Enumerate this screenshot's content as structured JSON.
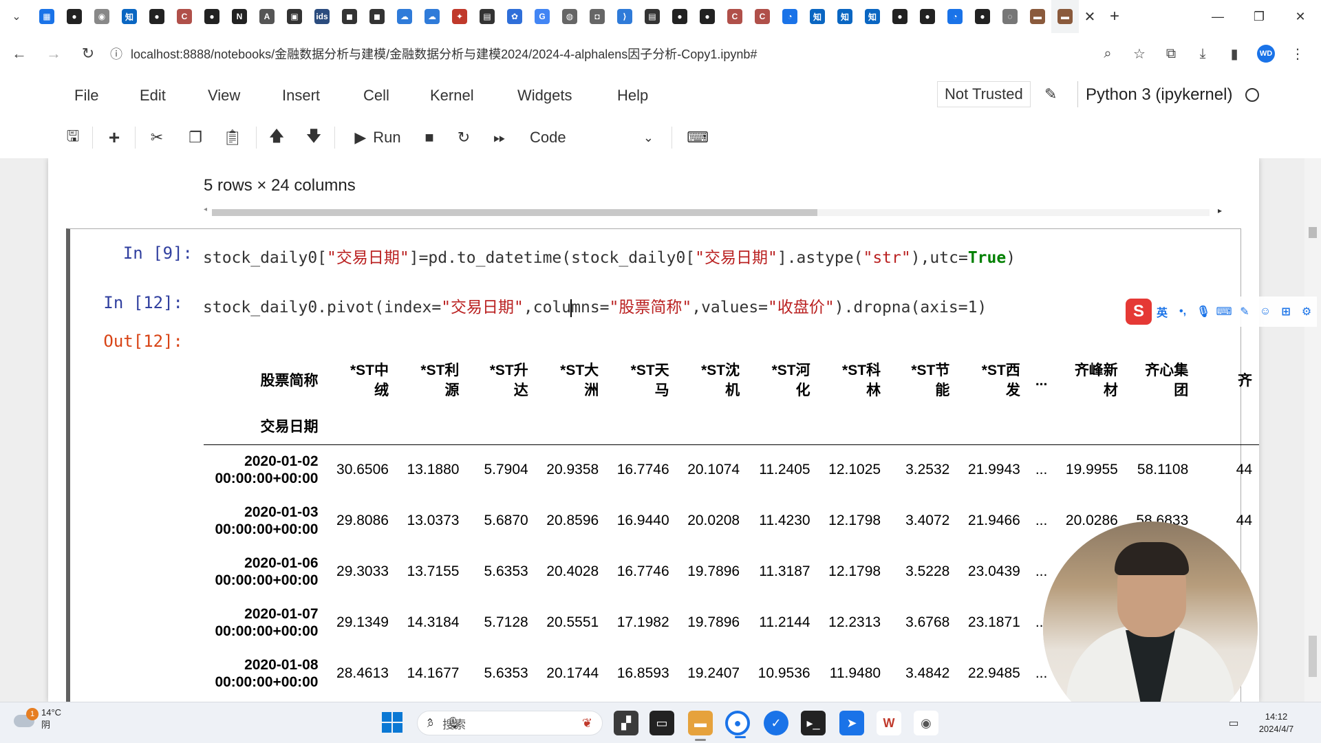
{
  "browser": {
    "tab_favicons": [
      {
        "name": "calendar",
        "glyph": "▦",
        "color": "#1a73e8"
      },
      {
        "name": "github",
        "glyph": "●",
        "color": "#222222"
      },
      {
        "name": "record",
        "glyph": "◉",
        "color": "#888888"
      },
      {
        "name": "zhihu",
        "glyph": "知",
        "color": "#0a66c2"
      },
      {
        "name": "github",
        "glyph": "●",
        "color": "#222222"
      },
      {
        "name": "c-site",
        "glyph": "C",
        "color": "#b0504a"
      },
      {
        "name": "github",
        "glyph": "●",
        "color": "#222222"
      },
      {
        "name": "notion",
        "glyph": "N",
        "color": "#222222"
      },
      {
        "name": "ai",
        "glyph": "A",
        "color": "#555555"
      },
      {
        "name": "bilibili",
        "glyph": "▣",
        "color": "#333333"
      },
      {
        "name": "ids",
        "glyph": "ids",
        "color": "#2b4c7e"
      },
      {
        "name": "dark",
        "glyph": "◼",
        "color": "#333333"
      },
      {
        "name": "dark",
        "glyph": "◼",
        "color": "#333333"
      },
      {
        "name": "cloud",
        "glyph": "☁",
        "color": "#2f7bd9"
      },
      {
        "name": "cloud",
        "glyph": "☁",
        "color": "#2f7bd9"
      },
      {
        "name": "runner",
        "glyph": "✦",
        "color": "#c0392b"
      },
      {
        "name": "book",
        "glyph": "▤",
        "color": "#333333"
      },
      {
        "name": "paw",
        "glyph": "✿",
        "color": "#2f6fd9"
      },
      {
        "name": "google",
        "glyph": "G",
        "color": "#4285f4"
      },
      {
        "name": "globe",
        "glyph": "◍",
        "color": "#666666"
      },
      {
        "name": "doc",
        "glyph": "◘",
        "color": "#666666"
      },
      {
        "name": "vscode",
        "glyph": "⟩",
        "color": "#2f7bd9"
      },
      {
        "name": "book",
        "glyph": "▤",
        "color": "#333333"
      },
      {
        "name": "github",
        "glyph": "●",
        "color": "#222222"
      },
      {
        "name": "github",
        "glyph": "●",
        "color": "#222222"
      },
      {
        "name": "c-site",
        "glyph": "C",
        "color": "#b0504a"
      },
      {
        "name": "c-site",
        "glyph": "C",
        "color": "#b0504a"
      },
      {
        "name": "compass",
        "glyph": "◔",
        "color": "#1a73e8"
      },
      {
        "name": "zhihu",
        "glyph": "知",
        "color": "#0a66c2"
      },
      {
        "name": "zhihu",
        "glyph": "知",
        "color": "#0a66c2"
      },
      {
        "name": "zhihu",
        "glyph": "知",
        "color": "#0a66c2"
      },
      {
        "name": "github",
        "glyph": "●",
        "color": "#222222"
      },
      {
        "name": "github",
        "glyph": "●",
        "color": "#222222"
      },
      {
        "name": "compass",
        "glyph": "◔",
        "color": "#1a73e8"
      },
      {
        "name": "github",
        "glyph": "●",
        "color": "#222222"
      },
      {
        "name": "loading",
        "glyph": "◌",
        "color": "#777777"
      },
      {
        "name": "ebook",
        "glyph": "▬",
        "color": "#8a5a3c"
      },
      {
        "name": "ebook",
        "glyph": "▬",
        "color": "#8a5a3c"
      }
    ],
    "url": "localhost:8888/notebooks/金融数据分析与建模/金融数据分析与建模2024/2024-4-alphalens因子分析-Copy1.ipynb#",
    "profile_initials": "WD"
  },
  "jupyter": {
    "menu": [
      "File",
      "Edit",
      "View",
      "Insert",
      "Cell",
      "Kernel",
      "Widgets",
      "Help"
    ],
    "trusted": "Not Trusted",
    "kernel": "Python 3 (ipykernel)",
    "run_label": "Run",
    "cell_type": "Code"
  },
  "notebook": {
    "rows_info": "5 rows × 24 columns",
    "cell9": {
      "prompt": "In  [9]:",
      "code_parts": [
        "stock_daily0[",
        "\"交易日期\"",
        "]=pd.to_datetime(stock_daily0[",
        "\"交易日期\"",
        "].astype(",
        "\"str\"",
        "),utc=",
        "True",
        ")"
      ]
    },
    "cell12": {
      "prompt": "In  [12]:",
      "out_prompt": "Out[12]:",
      "code_parts": [
        "stock_daily0.pivot(index=",
        "\"交易日期\"",
        ",colu",
        "mns=",
        "\"股票简称\"",
        ",values=",
        "\"收盘价\"",
        ").dropna(axis=1)"
      ]
    },
    "table": {
      "columns_name": "股票简称",
      "index_name": "交易日期",
      "columns": [
        [
          "*ST中",
          "绒"
        ],
        [
          "*ST利",
          "源"
        ],
        [
          "*ST升",
          "达"
        ],
        [
          "*ST大",
          "洲"
        ],
        [
          "*ST天",
          "马"
        ],
        [
          "*ST沈",
          "机"
        ],
        [
          "*ST河",
          "化"
        ],
        [
          "*ST科",
          "林"
        ],
        [
          "*ST节",
          "能"
        ],
        [
          "*ST西",
          "发"
        ],
        [
          "...",
          ""
        ],
        [
          "齐峰新",
          "材"
        ],
        [
          "齐心集",
          "团"
        ],
        [
          "齐",
          ""
        ]
      ],
      "rows": [
        {
          "date": "2020-01-02",
          "time": "00:00:00+00:00",
          "values": [
            "30.6506",
            "13.1880",
            "5.7904",
            "20.9358",
            "16.7746",
            "20.1074",
            "11.2405",
            "12.1025",
            "3.2532",
            "21.9943",
            "...",
            "19.9955",
            "58.1108",
            "44"
          ]
        },
        {
          "date": "2020-01-03",
          "time": "00:00:00+00:00",
          "values": [
            "29.8086",
            "13.0373",
            "5.6870",
            "20.8596",
            "16.9440",
            "20.0208",
            "11.4230",
            "12.1798",
            "3.4072",
            "21.9466",
            "...",
            "20.0286",
            "58.6833",
            "44"
          ]
        },
        {
          "date": "2020-01-06",
          "time": "00:00:00+00:00",
          "values": [
            "29.3033",
            "13.7155",
            "5.6353",
            "20.4028",
            "16.7746",
            "19.7896",
            "11.3187",
            "12.1798",
            "3.5228",
            "23.0439",
            "...",
            "",
            "",
            ""
          ]
        },
        {
          "date": "2020-01-07",
          "time": "00:00:00+00:00",
          "values": [
            "29.1349",
            "14.3184",
            "5.7128",
            "20.5551",
            "17.1982",
            "19.7896",
            "11.2144",
            "12.2313",
            "3.6768",
            "23.1871",
            "...",
            "",
            "",
            ""
          ]
        },
        {
          "date": "2020-01-08",
          "time": "00:00:00+00:00",
          "values": [
            "28.4613",
            "14.1677",
            "5.6353",
            "20.1744",
            "16.8593",
            "19.2407",
            "10.9536",
            "11.9480",
            "3.4842",
            "22.9485",
            "...",
            "",
            "",
            ""
          ]
        }
      ]
    }
  },
  "ime": {
    "lang": "英"
  },
  "taskbar": {
    "temperature": "14°C",
    "weather": "阴",
    "search_placeholder": "搜索",
    "time": "14:12",
    "date": "2024/4/7"
  }
}
